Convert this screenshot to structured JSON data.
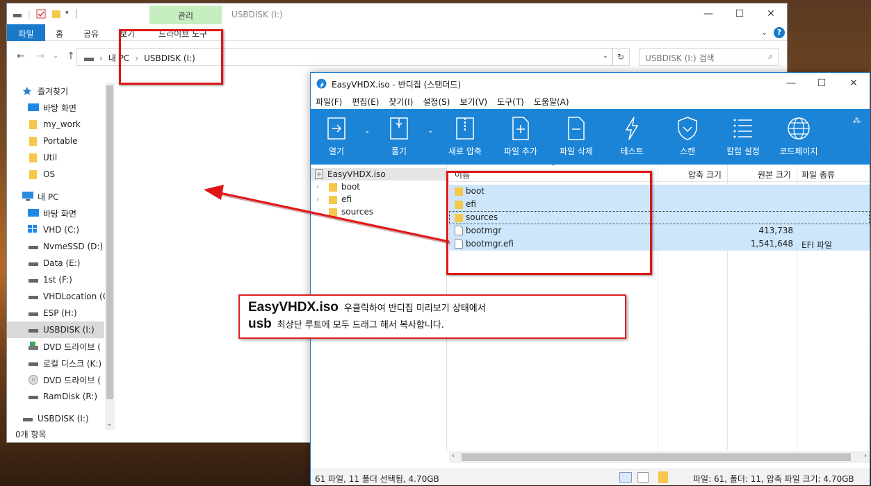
{
  "explorer": {
    "context_tab": "관리",
    "title": "USBDISK (I:)",
    "ribbon_tabs": [
      "파일",
      "홈",
      "공유",
      "보기",
      "드라이브 도구"
    ],
    "address": [
      "내 PC",
      "USBDISK (I:)"
    ],
    "search_placeholder": "USBDISK (I:) 검색",
    "nav": {
      "quick_access": "즐겨찾기",
      "pinned": [
        "바탕 화면",
        "my_work",
        "Portable",
        "Util",
        "OS"
      ],
      "this_pc": "내 PC",
      "drives": [
        "바탕 화면",
        "VHD (C:)",
        "NvmeSSD (D:)",
        "Data (E:)",
        "1st (F:)",
        "VHDLocation (G",
        "ESP (H:)",
        "USBDISK (I:)",
        "DVD 드라이브 (",
        "로컬 디스크 (K:)",
        "DVD 드라이브 (",
        "RamDisk (R:)"
      ],
      "usb_bottom": "USBDISK (I:)"
    },
    "status": "0개 항목"
  },
  "bandizip": {
    "title": "EasyVHDX.iso - 반디집 (스탠더드)",
    "menu": [
      "파일(F)",
      "편집(E)",
      "찾기(I)",
      "설정(S)",
      "보기(V)",
      "도구(T)",
      "도움말(A)"
    ],
    "toolbar": [
      "열기",
      "풀기",
      "새로 압축",
      "파일 추가",
      "파일 삭제",
      "테스트",
      "스캔",
      "칼럼 설정",
      "코드페이지"
    ],
    "tree": {
      "root": "EasyVHDX.iso",
      "children": [
        "boot",
        "efi",
        "sources"
      ]
    },
    "columns": {
      "name": "이름",
      "compressed": "압축 크기",
      "original": "원본 크기",
      "type": "파일 종류"
    },
    "files": [
      {
        "name": "boot",
        "kind": "folder",
        "size": "",
        "type": ""
      },
      {
        "name": "efi",
        "kind": "folder",
        "size": "",
        "type": ""
      },
      {
        "name": "sources",
        "kind": "folder",
        "size": "",
        "type": ""
      },
      {
        "name": "bootmgr",
        "kind": "file",
        "size": "413,738",
        "type": ""
      },
      {
        "name": "bootmgr.efi",
        "kind": "file",
        "size": "1,541,648",
        "type": "EFI 파일"
      }
    ],
    "status_left": "61 파일, 11 폴더 선택됨, 4.70GB",
    "status_right": "파일: 61, 폴더: 11, 압축 파일 크기: 4.70GB"
  },
  "callout": {
    "line1_bold": "EasyVHDX.iso",
    "line1_rest": "우클릭하여 반디집 미리보기 상태에서",
    "line2_bold": "usb",
    "line2_rest": "최상단 루트에 모두 드래그 해서 복사합니다."
  },
  "colors": {
    "accent": "#1979ca",
    "toolbar": "#1c84d6",
    "selection": "#cde6fb",
    "annotation": "#e01515"
  }
}
